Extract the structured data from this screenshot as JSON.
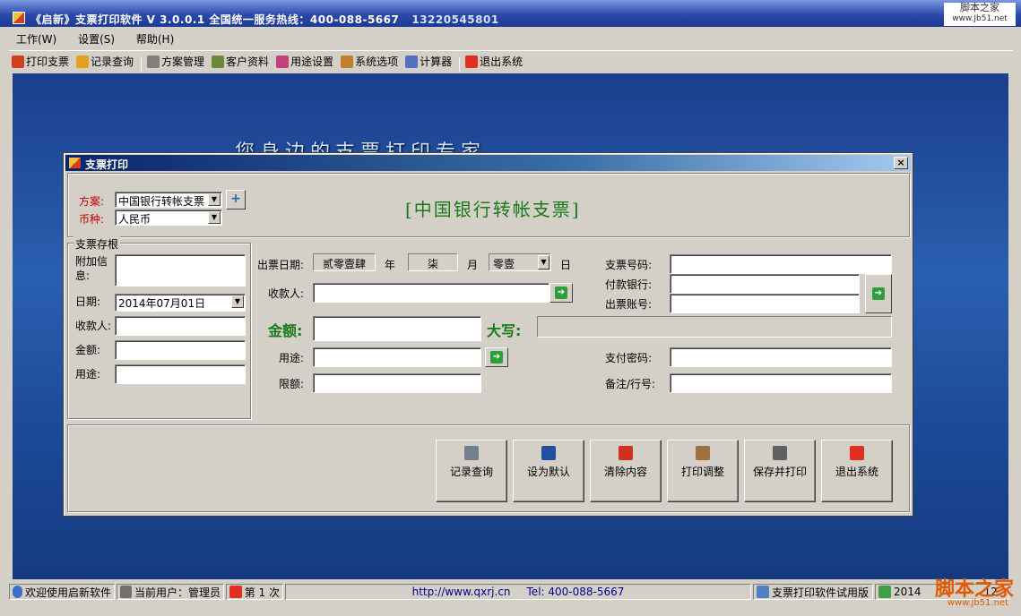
{
  "window": {
    "title": "《启新》支票打印软件 V 3.0.0.1 全国统一服务热线：400-088-5667",
    "phone": "13220545801",
    "watermark_top": "脚本之家",
    "watermark_top_url": "www.Jb51.net"
  },
  "menu": [
    {
      "label": "工作(W)"
    },
    {
      "label": "设置(S)"
    },
    {
      "label": "帮助(H)"
    }
  ],
  "toolbar": [
    {
      "label": "打印支票",
      "icon": "print-cheque-icon",
      "color": "#d04020"
    },
    {
      "label": "记录查询",
      "icon": "records-icon",
      "color": "#e0a020"
    },
    {
      "label": "方案管理",
      "icon": "tools-icon",
      "color": "#808080"
    },
    {
      "label": "客户资料",
      "icon": "customer-icon",
      "color": "#6a8a3a"
    },
    {
      "label": "用途设置",
      "icon": "purpose-icon",
      "color": "#c04080"
    },
    {
      "label": "系统选项",
      "icon": "system-options-icon",
      "color": "#c08030"
    },
    {
      "label": "计算器",
      "icon": "calculator-icon",
      "color": "#5070c0"
    },
    {
      "label": "退出系统",
      "icon": "exit-icon",
      "color": "#e03020"
    }
  ],
  "desktop": {
    "slogan": "您身边的支票打印专家"
  },
  "dialog": {
    "title": "支票打印",
    "close": "×",
    "scheme": {
      "scheme_label": "方案:",
      "scheme_value": "中国银行转帐支票",
      "currency_label": "币种:",
      "currency_value": "人民币",
      "add": "+",
      "cheque_type": "[中国银行转帐支票]"
    },
    "stub": {
      "group_title": "支票存根",
      "extra_info_label": "附加信息:",
      "extra_info_value": "",
      "date_label": "日期:",
      "date_value": "2014年07月01日",
      "payee_label": "收款人:",
      "payee_value": "",
      "amount_label": "金额:",
      "amount_value": "",
      "purpose_label": "用途:",
      "purpose_value": ""
    },
    "form": {
      "issue_date_label": "出票日期:",
      "year_value": "贰零壹肆",
      "year_unit": "年",
      "month_value": "柒",
      "month_unit": "月",
      "day_value": "零壹",
      "day_unit": "日",
      "payee_label": "收款人:",
      "payee_value": "",
      "amount_label": "金额:",
      "amount_value": "",
      "uppercase_label": "大写:",
      "uppercase_value": "",
      "purpose_label": "用途:",
      "purpose_value": "",
      "limit_label": "限额:",
      "limit_value": "",
      "cheque_no_label": "支票号码:",
      "cheque_no_value": "",
      "bank_label": "付款银行:",
      "bank_value": "",
      "account_label": "出票账号:",
      "account_value": "",
      "password_label": "支付密码:",
      "password_value": "",
      "remark_label": "备注/行号:",
      "remark_value": ""
    },
    "buttons": [
      {
        "label": "记录查询",
        "icon": "search-records-icon",
        "color": "#708090"
      },
      {
        "label": "设为默认",
        "icon": "save-icon",
        "color": "#2050a0"
      },
      {
        "label": "清除内容",
        "icon": "clear-icon",
        "color": "#d03020"
      },
      {
        "label": "打印调整",
        "icon": "print-adjust-icon",
        "color": "#a07040"
      },
      {
        "label": "保存并打印",
        "icon": "printer-icon",
        "color": "#606060"
      },
      {
        "label": "退出系统",
        "icon": "exit-icon",
        "color": "#e03020"
      }
    ]
  },
  "statusbar": {
    "welcome": "欢迎使用启新软件",
    "user": "当前用户：管理员",
    "count": "第 1 次",
    "website": "http://www.qxrj.cn",
    "tel": "Tel: 400-088-5667",
    "edition": "支票打印软件试用版",
    "date_partial": "2014",
    "time_partial": "12"
  },
  "watermark_bottom": {
    "text": "脚本之家",
    "url": "www.jb51.net"
  }
}
